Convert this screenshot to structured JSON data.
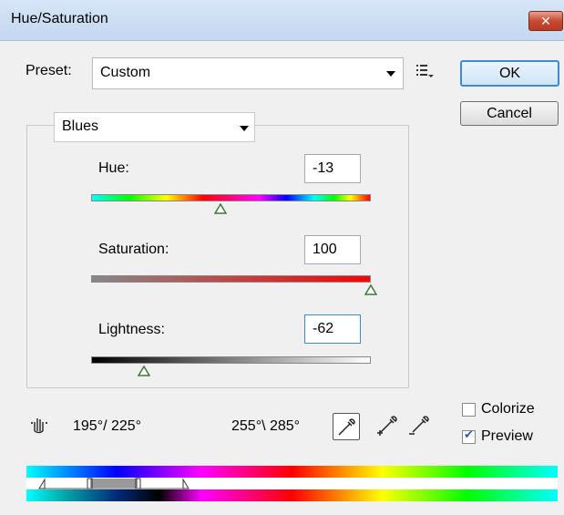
{
  "window": {
    "title": "Hue/Saturation",
    "close_glyph": "✕"
  },
  "preset": {
    "label": "Preset:",
    "value": "Custom"
  },
  "buttons": {
    "ok": "OK",
    "cancel": "Cancel"
  },
  "channel": {
    "value": "Blues"
  },
  "hue": {
    "label": "Hue:",
    "value": "-13",
    "min": -180,
    "max": 180
  },
  "saturation": {
    "label": "Saturation:",
    "value": "100",
    "min": -100,
    "max": 100
  },
  "lightness": {
    "label": "Lightness:",
    "value": "-62",
    "min": -100,
    "max": 100
  },
  "range": {
    "left": "195°/ 225°",
    "right": "255°\\ 285°"
  },
  "options": {
    "colorize": {
      "label": "Colorize",
      "checked": false
    },
    "preview": {
      "label": "Preview",
      "checked": true
    }
  },
  "icons": [
    "hand-adjust-icon",
    "eyedropper-icon",
    "eyedropper-plus-icon",
    "eyedropper-minus-icon",
    "preset-options-icon"
  ],
  "colors": {
    "accent": "#3c8ad8",
    "close": "#c74a32",
    "thumb_stroke": "#3a7a3a"
  }
}
